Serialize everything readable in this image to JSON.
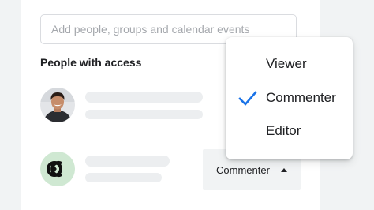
{
  "share_dialog": {
    "search": {
      "placeholder": "Add people, groups and calendar events"
    },
    "section_title": "People with access",
    "people": [
      {
        "avatar": "profile-photo",
        "role": ""
      },
      {
        "avatar": "company-logo",
        "role": "Commenter"
      }
    ]
  },
  "role_menu": {
    "items": [
      {
        "label": "Viewer",
        "selected": false
      },
      {
        "label": "Commenter",
        "selected": true
      },
      {
        "label": "Editor",
        "selected": false
      }
    ]
  },
  "colors": {
    "accent": "#1a73e8",
    "logo_bg": "#cfe8d2",
    "logo_fg": "#111111",
    "placeholder_line": "#eceef0"
  }
}
